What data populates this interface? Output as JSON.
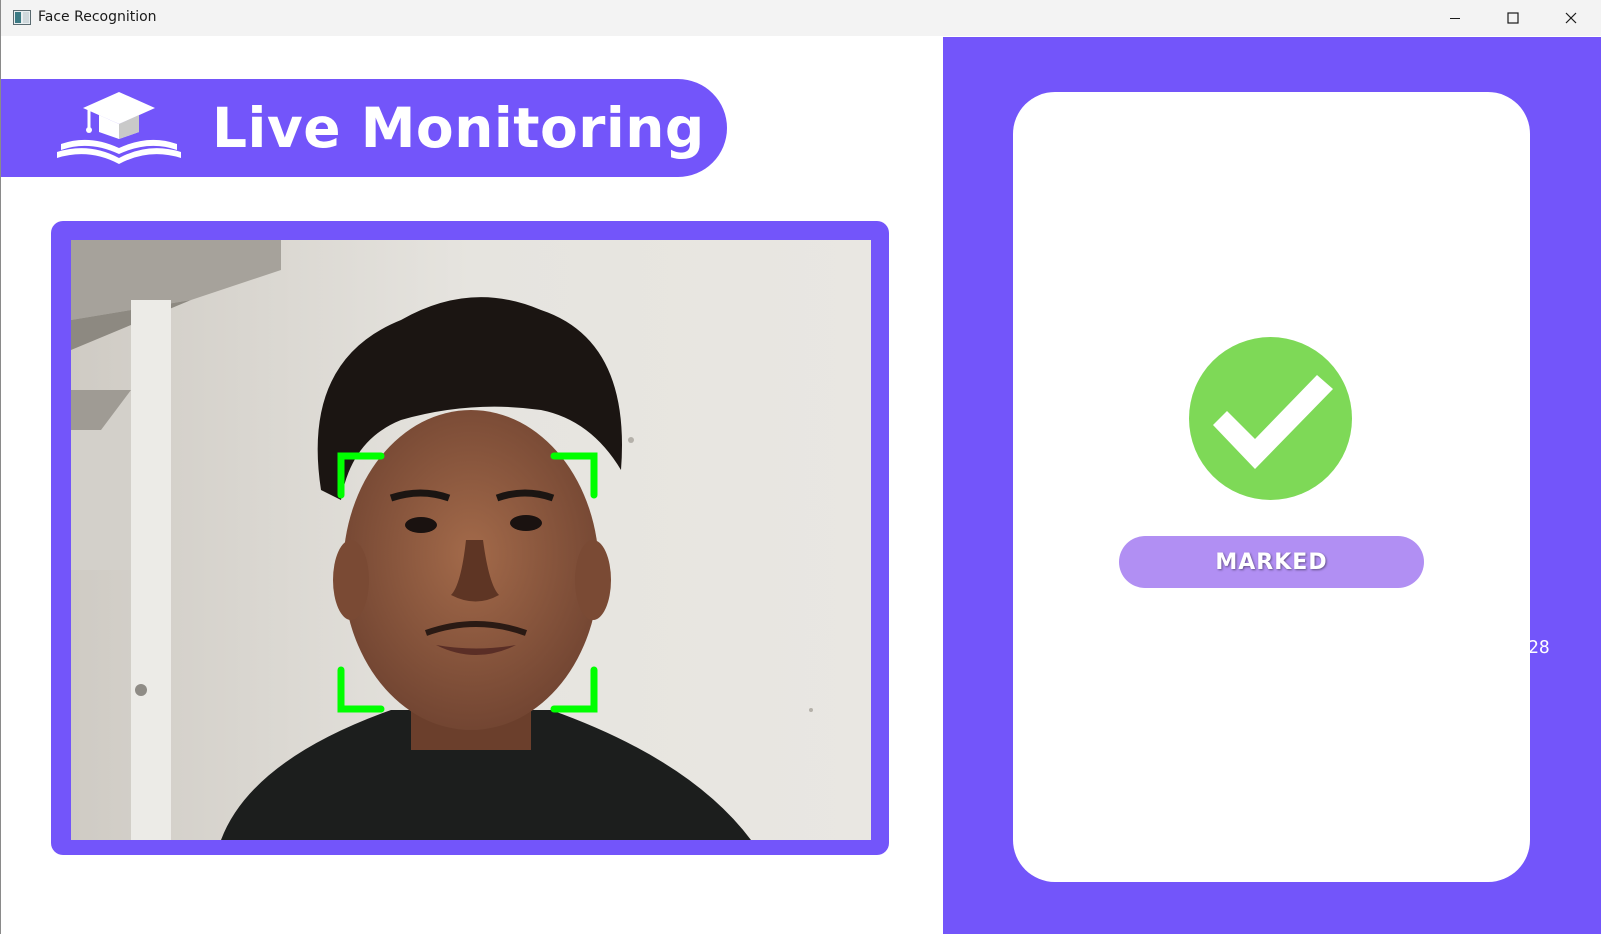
{
  "window": {
    "title": "Face Recognition"
  },
  "banner": {
    "title": "Live Monitoring",
    "logo_icon": "graduation-cap-book-icon"
  },
  "camera": {
    "feed": "webcam-live-feed",
    "detection_box_color": "#00ff00"
  },
  "status": {
    "icon": "check-circle-icon",
    "label": "MARKED",
    "number_fragment": "28"
  },
  "colors": {
    "accent": "#7355fa",
    "success": "#7ed957",
    "badge": "#b18ff3",
    "detection": "#00ff00"
  }
}
